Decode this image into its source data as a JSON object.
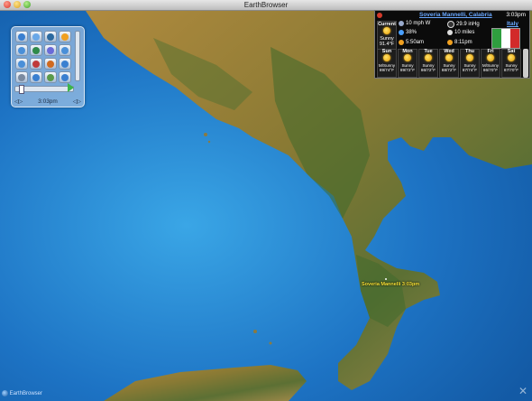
{
  "window": {
    "title": "EarthBrowser"
  },
  "map": {
    "place_label": "Soveria Mannelli 3:03pm"
  },
  "controls": {
    "time": "3:03pm",
    "prev_arrow": "◁▷",
    "next_arrow": "◁▷",
    "icons": [
      "globe-icon",
      "cloud-icon",
      "satellite-icon",
      "sun-icon",
      "zoom-in-icon",
      "home-icon",
      "camera-icon",
      "search-icon",
      "gps-icon",
      "earthquake-icon",
      "volcano-icon",
      "info-icon",
      "settings-icon",
      "clock-icon",
      "chart-icon",
      "help-icon"
    ]
  },
  "weather": {
    "city": "Soveria Mannelli, Calabria",
    "time": "3:03pm",
    "country": "Italy",
    "current": {
      "title": "Current",
      "condition": "Sunny",
      "temp": "91.4°F"
    },
    "wind": "10 mph W",
    "pressure": "29.9 inHg",
    "humidity": "38%",
    "visibility": "10 miles",
    "sunrise": "5:50am",
    "sunset": "8:11pm",
    "flag_colors": [
      "#2f9e3f",
      "#ffffff",
      "#d22a2a"
    ],
    "forecast": [
      {
        "day": "Sun",
        "cond": "M/Sunny",
        "temp": "89/74°F"
      },
      {
        "day": "Mon",
        "cond": "Sunny",
        "temp": "89/72°F"
      },
      {
        "day": "Tue",
        "cond": "Sunny",
        "temp": "86/72°F"
      },
      {
        "day": "Wed",
        "cond": "Sunny",
        "temp": "88/72°F"
      },
      {
        "day": "Thu",
        "cond": "Sunny",
        "temp": "87/74°F"
      },
      {
        "day": "Fri",
        "cond": "M/Sunny",
        "temp": "86/70°F"
      },
      {
        "day": "Sat",
        "cond": "Sunny",
        "temp": "87/70°F"
      }
    ]
  },
  "branding": {
    "logo": "EarthBrowser"
  }
}
